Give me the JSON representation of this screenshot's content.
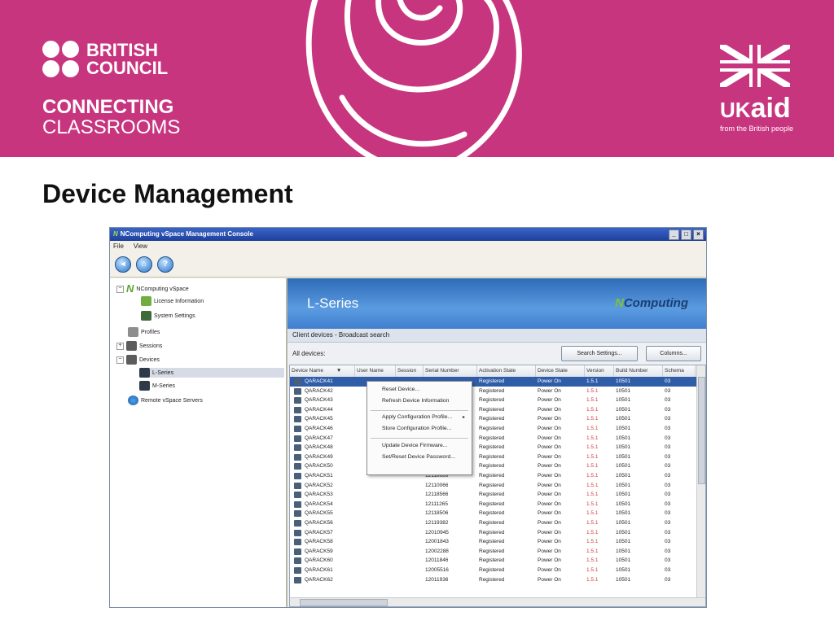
{
  "banner": {
    "bc_line1": "BRITISH",
    "bc_line2": "COUNCIL",
    "connecting": "CONNECTING",
    "classrooms": "CLASSROOMS",
    "ukaid_uk": "UK",
    "ukaid_aid": "aid",
    "ukaid_sub": "from the British people",
    "bg_color": "#c8357f"
  },
  "slide_title": "Device Management",
  "window": {
    "title": "NComputing vSpace Management Console",
    "logo_glyph": "N",
    "controls": [
      "_",
      "□",
      "×"
    ],
    "menu": [
      "File",
      "View"
    ],
    "toolbar_icons": [
      "back-icon",
      "home-icon",
      "help-icon"
    ],
    "toolbar_glyphs": [
      "◂",
      "⌂",
      "?"
    ]
  },
  "tree": {
    "items": [
      {
        "label": "NComputing vSpace",
        "icon": "ncomputing-logo-icon",
        "expander": "−"
      },
      {
        "label": "License Information",
        "icon": "license-icon"
      },
      {
        "label": "System Settings",
        "icon": "settings-icon"
      },
      {
        "label": "Profiles",
        "icon": "profiles-icon"
      },
      {
        "label": "Sessions",
        "icon": "sessions-icon",
        "expander": "+"
      },
      {
        "label": "Devices",
        "icon": "devices-icon",
        "expander": "−"
      },
      {
        "label": "L-Series",
        "icon": "device-icon"
      },
      {
        "label": "M-Series",
        "icon": "device-icon"
      },
      {
        "label": "Remote vSpace Servers",
        "icon": "globe-icon"
      }
    ]
  },
  "main": {
    "header_title": "L-Series",
    "brand_n": "N",
    "brand_rest": "Computing",
    "breadcrumb": "Client devices - Broadcast search",
    "all_devices_label": "All devices:",
    "search_settings_button": "Search Settings...",
    "columns_button": "Columns...",
    "columns": [
      "Device Name",
      "User Name",
      "Session",
      "Serial Number",
      "Activation State",
      "Device State",
      "Version",
      "Build Number",
      "Schema"
    ],
    "sort_glyph": "▼",
    "rows": [
      {
        "name": "QARACK41",
        "serial": "",
        "activation": "Registered",
        "state": "Power On",
        "version": "1.5.1",
        "build": "10501",
        "schema": "03",
        "selected": true
      },
      {
        "name": "QARACK42",
        "serial": "",
        "activation": "Registered",
        "state": "Power On",
        "version": "1.5.1",
        "build": "10501",
        "schema": "03"
      },
      {
        "name": "QARACK43",
        "serial": "",
        "activation": "Registered",
        "state": "Power On",
        "version": "1.5.1",
        "build": "10501",
        "schema": "03"
      },
      {
        "name": "QARACK44",
        "serial": "",
        "activation": "Registered",
        "state": "Power On",
        "version": "1.5.1",
        "build": "10501",
        "schema": "03"
      },
      {
        "name": "QARACK45",
        "serial": "",
        "activation": "Registered",
        "state": "Power On",
        "version": "1.5.1",
        "build": "10501",
        "schema": "03"
      },
      {
        "name": "QARACK46",
        "serial": "",
        "activation": "Registered",
        "state": "Power On",
        "version": "1.5.1",
        "build": "10501",
        "schema": "03"
      },
      {
        "name": "QARACK47",
        "serial": "",
        "activation": "Registered",
        "state": "Power On",
        "version": "1.5.1",
        "build": "10501",
        "schema": "03"
      },
      {
        "name": "QARACK48",
        "serial": "",
        "activation": "Registered",
        "state": "Power On",
        "version": "1.5.1",
        "build": "10501",
        "schema": "03"
      },
      {
        "name": "QARACK49",
        "serial": "",
        "activation": "Registered",
        "state": "Power On",
        "version": "1.5.1",
        "build": "10501",
        "schema": "03"
      },
      {
        "name": "QARACK50",
        "serial": "12119400",
        "activation": "Registered",
        "state": "Power On",
        "version": "1.5.1",
        "build": "10501",
        "schema": "03"
      },
      {
        "name": "QARACK51",
        "serial": "12118689",
        "activation": "Registered",
        "state": "Power On",
        "version": "1.5.1",
        "build": "10501",
        "schema": "03"
      },
      {
        "name": "QARACK52",
        "serial": "12110066",
        "activation": "Registered",
        "state": "Power On",
        "version": "1.5.1",
        "build": "10501",
        "schema": "03"
      },
      {
        "name": "QARACK53",
        "serial": "12118566",
        "activation": "Registered",
        "state": "Power On",
        "version": "1.5.1",
        "build": "10501",
        "schema": "03"
      },
      {
        "name": "QARACK54",
        "serial": "12111265",
        "activation": "Registered",
        "state": "Power On",
        "version": "1.5.1",
        "build": "10501",
        "schema": "03"
      },
      {
        "name": "QARACK55",
        "serial": "12118506",
        "activation": "Registered",
        "state": "Power On",
        "version": "1.5.1",
        "build": "10501",
        "schema": "03"
      },
      {
        "name": "QARACK56",
        "serial": "12119382",
        "activation": "Registered",
        "state": "Power On",
        "version": "1.5.1",
        "build": "10501",
        "schema": "03"
      },
      {
        "name": "QARACK57",
        "serial": "12010945",
        "activation": "Registered",
        "state": "Power On",
        "version": "1.5.1",
        "build": "10501",
        "schema": "03"
      },
      {
        "name": "QARACK58",
        "serial": "12001843",
        "activation": "Registered",
        "state": "Power On",
        "version": "1.5.1",
        "build": "10501",
        "schema": "03"
      },
      {
        "name": "QARACK59",
        "serial": "12002288",
        "activation": "Registered",
        "state": "Power On",
        "version": "1.5.1",
        "build": "10501",
        "schema": "03"
      },
      {
        "name": "QARACK60",
        "serial": "12011846",
        "activation": "Registered",
        "state": "Power On",
        "version": "1.5.1",
        "build": "10501",
        "schema": "03"
      },
      {
        "name": "QARACK61",
        "serial": "12005516",
        "activation": "Registered",
        "state": "Power On",
        "version": "1.5.1",
        "build": "10501",
        "schema": "03"
      },
      {
        "name": "QARACK62",
        "serial": "12011936",
        "activation": "Registered",
        "state": "Power On",
        "version": "1.5.1",
        "build": "10501",
        "schema": "03"
      }
    ],
    "version_color": "#d23a3a"
  },
  "context_menu": {
    "items": [
      {
        "label": "Reset Device..."
      },
      {
        "label": "Refresh Device Information"
      },
      {
        "separator": true
      },
      {
        "label": "Apply Configuration Profile...",
        "submenu": true
      },
      {
        "label": "Store Configuration Profile..."
      },
      {
        "separator": true
      },
      {
        "label": "Update Device Firmware..."
      },
      {
        "label": "Set/Reset Device Password..."
      }
    ],
    "submenu_glyph": "▸"
  }
}
